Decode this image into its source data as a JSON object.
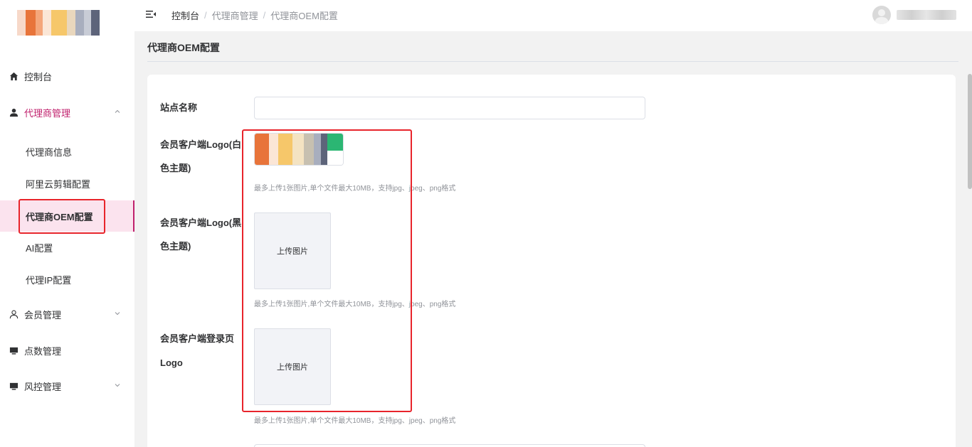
{
  "sidebar": {
    "menu": [
      {
        "label": "控制台",
        "icon": "home-icon"
      },
      {
        "label": "代理商管理",
        "icon": "user-icon",
        "expanded": true
      },
      {
        "label": "会员管理",
        "icon": "person-outline-icon"
      },
      {
        "label": "点数管理",
        "icon": "monitor-icon"
      },
      {
        "label": "风控管理",
        "icon": "monitor-icon"
      }
    ],
    "submenu": [
      {
        "label": "代理商信息"
      },
      {
        "label": "阿里云剪辑配置"
      },
      {
        "label": "代理商OEM配置",
        "selected": true
      },
      {
        "label": "AI配置"
      },
      {
        "label": "代理IP配置"
      }
    ]
  },
  "header": {
    "breadcrumb": [
      "控制台",
      "代理商管理",
      "代理商OEM配置"
    ],
    "separator": "/"
  },
  "page": {
    "title": "代理商OEM配置"
  },
  "form": {
    "site_name_label": "站点名称",
    "site_name_value": "",
    "logo_white_label_1": "会员客户端Logo(白",
    "logo_white_label_2": "色主题)",
    "logo_dark_label_1": "会员客户端Logo(黑",
    "logo_dark_label_2": "色主题)",
    "login_logo_label_1": "会员客户端登录页",
    "login_logo_label_2": "Logo",
    "upload_text": "上传图片",
    "upload_tip": "最多上传1张图片,单个文件最大10MB，支持jpg、jpeg、png格式"
  },
  "colors": {
    "accent": "#c0216d",
    "highlight_box": "#e8242b",
    "selected_bg": "#fbe3ee"
  }
}
